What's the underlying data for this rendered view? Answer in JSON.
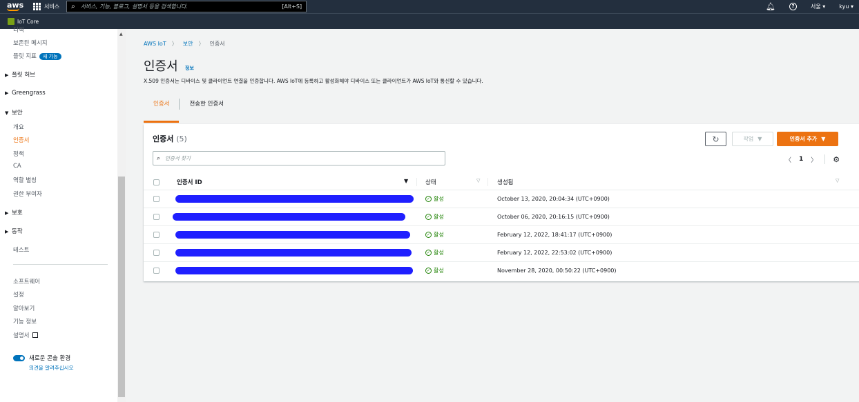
{
  "topnav": {
    "logo": "aws",
    "services": "서비스",
    "search_placeholder": "서비스, 기능, 블로그, 설명서 등을 검색합니다.",
    "search_shortcut": "[Alt+S]",
    "region": "서울 ▾",
    "user": "kyu ▾",
    "icons": [
      "bell-icon",
      "help-icon"
    ]
  },
  "subnav": {
    "service": "IoT Core"
  },
  "sidebar": {
    "top_cut": "디렉",
    "items": [
      {
        "label": "보존된 메시지"
      },
      {
        "label": "플릿 지표",
        "badge": "새 기능"
      }
    ],
    "groups": [
      {
        "label": "플릿 허브"
      },
      {
        "label": "Greengrass"
      },
      {
        "label": "보안"
      }
    ],
    "security_items": [
      "개요",
      "인증서",
      "정책",
      "CA",
      "역할 별칭",
      "권한 부여자"
    ],
    "groups2": [
      {
        "label": "보호"
      },
      {
        "label": "동작"
      }
    ],
    "test": "테스트",
    "bottom_items": [
      "소프트웨어",
      "설정",
      "알아보기",
      "기능 정보",
      "설명서"
    ],
    "toggle_label": "새로운 콘솔 환경",
    "feedback": "의견을 알려주십시오"
  },
  "breadcrumb": {
    "root": "AWS IoT",
    "section": "보안",
    "current": "인증서"
  },
  "page": {
    "title": "인증서",
    "info": "정보",
    "description": "X.509 인증서는 디바이스 및 클라이언트 연결을 인증합니다. AWS IoT에 등록하고 활성화해야 디바이스 또는 클라이언트가 AWS IoT와 통신할 수 있습니다."
  },
  "tabs": [
    {
      "label": "인증서"
    },
    {
      "label": "전송한 인증서"
    }
  ],
  "panel": {
    "title": "인증서",
    "count": "(5)",
    "action_button": "작업",
    "add_button": "인증서 추가",
    "filter_placeholder": "인증서 찾기",
    "page": "1"
  },
  "table": {
    "columns": [
      "인증서 ID",
      "상태",
      "생성됨"
    ],
    "rows": [
      {
        "status": "활성",
        "created": "October 13, 2020, 20:04:34 (UTC+0900)"
      },
      {
        "status": "활성",
        "created": "October 06, 2020, 20:16:15 (UTC+0900)"
      },
      {
        "status": "활성",
        "created": "February 12, 2022, 18:41:17 (UTC+0900)"
      },
      {
        "status": "활성",
        "created": "February 12, 2022, 22:53:02 (UTC+0900)"
      },
      {
        "status": "활성",
        "created": "November 28, 2020, 00:50:22 (UTC+0900)"
      }
    ]
  },
  "colors": {
    "nav": "#232f3e",
    "accent": "#ec7211",
    "link": "#0073bb",
    "success": "#1d8102"
  }
}
